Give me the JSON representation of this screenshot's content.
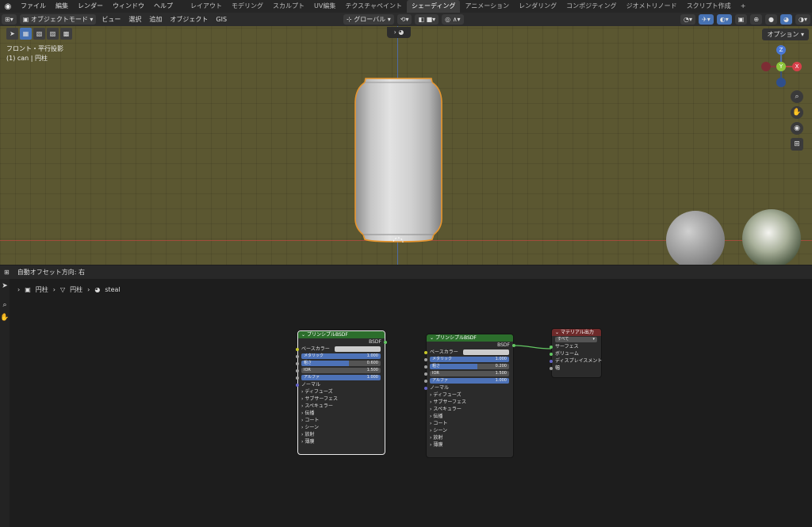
{
  "menubar": {
    "menus": [
      "ファイル",
      "編集",
      "レンダー",
      "ウィンドウ",
      "ヘルプ"
    ],
    "workspaces": [
      "レイアウト",
      "モデリング",
      "スカルプト",
      "UV編集",
      "テクスチャペイント",
      "シェーディング",
      "アニメーション",
      "レンダリング",
      "コンポジティング",
      "ジオメトリノード",
      "スクリプト作成"
    ],
    "active_workspace": "シェーディング",
    "add_tab": "+"
  },
  "viewport": {
    "mode": "オブジェクトモード",
    "menus": [
      "ビュー",
      "選択",
      "追加",
      "オブジェクト",
      "GIS"
    ],
    "transform_orientation": "グローバル",
    "options_label": "オプション",
    "view_name": "フロント・平行投影",
    "object_info": "(1) can | 円柱",
    "axes": {
      "z": "Z",
      "y": "Y",
      "x": "X"
    }
  },
  "node_editor": {
    "header_text": "自動オフセット方向: 右",
    "breadcrumb": [
      "円柱",
      "円柱",
      "steal"
    ],
    "node1": {
      "title": "プリンシプルBSDF",
      "output": "BSDF",
      "base_color": "ベースカラー",
      "metallic_label": "メタリック",
      "metallic_value": "1.000",
      "roughness_label": "粗さ",
      "roughness_value": "0.600",
      "ior_label": "IOR",
      "ior_value": "1.500",
      "alpha_label": "アルファ",
      "alpha_value": "1.000",
      "normal": "ノーマル",
      "panels": [
        "ディフューズ",
        "サブサーフェス",
        "スペキュラー",
        "伝播",
        "コート",
        "シーン",
        "放射",
        "薄膜"
      ]
    },
    "node2": {
      "title": "プリンシプルBSDF",
      "output": "BSDF",
      "base_color": "ベースカラー",
      "metallic_label": "メタリック",
      "metallic_value": "1.000",
      "roughness_label": "粗さ",
      "roughness_value": "0.200",
      "ior_label": "IOR",
      "ior_value": "1.500",
      "alpha_label": "アルファ",
      "alpha_value": "1.000",
      "normal": "ノーマル",
      "panels": [
        "ディフューズ",
        "サブサーフェス",
        "スペキュラー",
        "伝播",
        "コート",
        "シーン",
        "放射",
        "薄膜"
      ]
    },
    "output_node": {
      "title": "マテリアル出力",
      "target": "すべて",
      "sockets": [
        "サーフェス",
        "ボリューム",
        "ディスプレイスメント",
        "幅"
      ]
    }
  }
}
